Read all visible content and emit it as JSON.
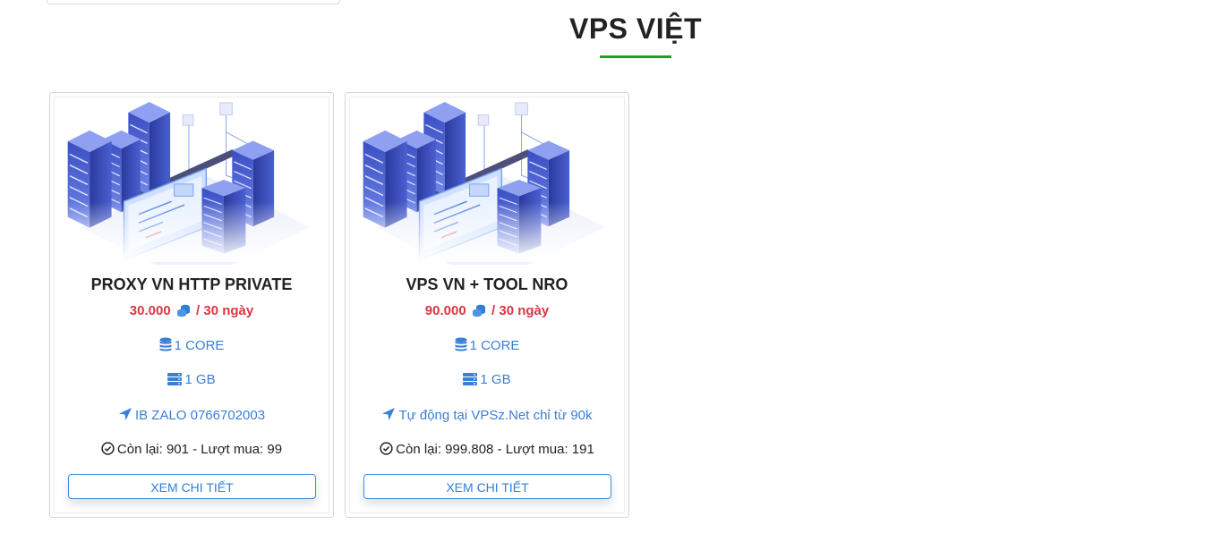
{
  "section": {
    "title": "VPS VIỆT"
  },
  "products": [
    {
      "title": "PROXY VN HTTP PRIVATE",
      "price": "30.000",
      "period": "/ 30 ngày",
      "cpu": "1 CORE",
      "ram": "1 GB",
      "note": "IB ZALO 0766702003",
      "stock": "Còn lại: 901 - Lượt mua: 99",
      "button": "XEM CHI TIẾT"
    },
    {
      "title": "VPS VN + TOOL NRO",
      "price": "90.000",
      "period": "/ 30 ngày",
      "cpu": "1 CORE",
      "ram": "1 GB",
      "note": "Tự động tại VPSz.Net chỉ từ 90k",
      "stock": "Còn lại: 999.808 - Lượt mua: 191",
      "button": "XEM CHI TIẾT"
    }
  ],
  "icons": {
    "price": "coins-icon",
    "cpu": "database-icon",
    "ram": "server-icon",
    "note": "location-arrow-icon",
    "stock": "check-circle-icon"
  },
  "colors": {
    "accent_green": "#1a9e2f",
    "price_red": "#dc3545",
    "link_blue": "#3a7fd6"
  }
}
